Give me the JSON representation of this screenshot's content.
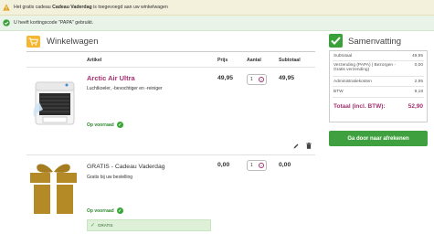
{
  "notices": {
    "warning_prefix": "Het gratis cadeau",
    "warning_bold": "Cadeau Vaderdag",
    "warning_suffix": "is toegevoegd aan uw winkelwagen",
    "success": "U heeft kortingscode \"PAPA\" gebruikt."
  },
  "cart": {
    "title": "Winkelwagen",
    "columns": {
      "article": "Artikel",
      "price": "Prijs",
      "qty": "Aantal",
      "subtotal": "Subtotaal"
    },
    "items": [
      {
        "name": "Arctic Air Ultra",
        "description": "Luchtkoeler, -bevochtiger en -reiniger",
        "stock": "Op voorraad",
        "price": "49,95",
        "qty": "1",
        "subtotal": "49,95"
      },
      {
        "name": "GRATIS - Cadeau Vaderdag",
        "description": "Gratis bij uw bestelling",
        "stock": "Op voorraad",
        "price": "0,00",
        "qty": "1",
        "subtotal": "0,00",
        "badge": "GRATIS"
      }
    ]
  },
  "summary": {
    "title": "Samenvatting",
    "rows": [
      {
        "label": "Subtotaal",
        "value": "49,95"
      },
      {
        "label": "Verzending (PAPA) | Bezorgen -",
        "label2": "Gratis verzending)",
        "value": "0,00"
      },
      {
        "label": "Administratiekosten",
        "value": "2,95"
      },
      {
        "label": "BTW",
        "value": "9,18"
      }
    ],
    "total_label": "Totaal (incl. BTW):",
    "total_value": "52,90"
  },
  "checkout_button": "Ga door naar afrekenen",
  "colors": {
    "accent": "#a3316f",
    "success": "#3fa03f",
    "cart_icon": "#f5b731"
  }
}
